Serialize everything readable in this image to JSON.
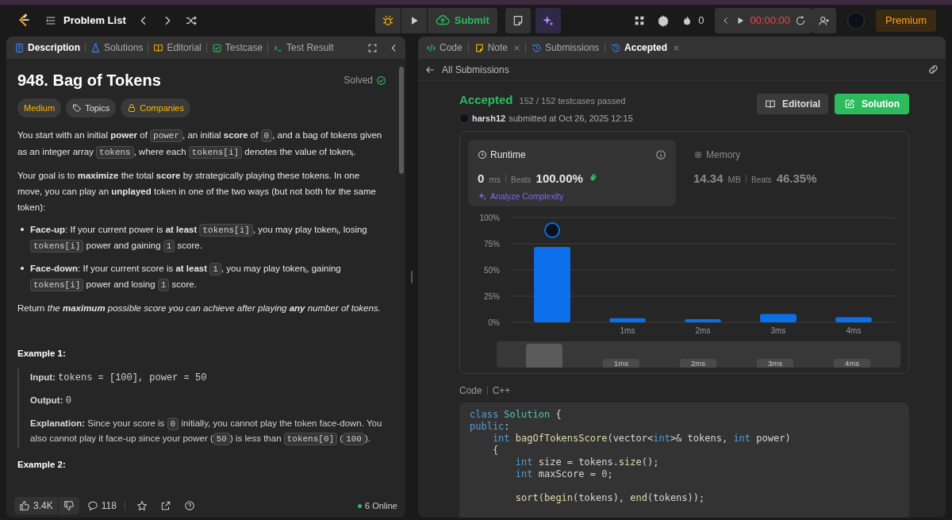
{
  "topbar": {
    "problem_list": "Problem List",
    "submit": "Submit",
    "streak": "0",
    "timer": "00:00:00",
    "premium": "Premium"
  },
  "left_tabs": [
    {
      "label": "Description",
      "selected": true
    },
    {
      "label": "Solutions",
      "selected": false
    },
    {
      "label": "Editorial",
      "selected": false
    },
    {
      "label": "Testcase",
      "selected": false
    },
    {
      "label": "Test Result",
      "selected": false
    }
  ],
  "problem": {
    "title": "948. Bag of Tokens",
    "status": "Solved",
    "difficulty": "Medium",
    "topics": "Topics",
    "companies": "Companies",
    "paragraphs": [
      {
        "kind": "para",
        "segments": [
          {
            "kind": "text",
            "text": "You start with an initial **power** of "
          },
          {
            "kind": "code",
            "text": "power"
          },
          {
            "kind": "text",
            "text": ", an initial **score** of "
          },
          {
            "kind": "code",
            "text": "0"
          },
          {
            "kind": "text",
            "text": ", and a bag of tokens given as an integer array "
          },
          {
            "kind": "code",
            "text": "tokens"
          },
          {
            "kind": "text",
            "text": ", where each "
          },
          {
            "kind": "code",
            "text": "tokens[i]"
          },
          {
            "kind": "text",
            "text": " denotes the value of token$_{i}$."
          }
        ]
      },
      {
        "kind": "para",
        "segments": [
          {
            "kind": "text",
            "text": "Your goal is to **maximize** the total **score** by strategically playing these tokens. In one move, you can play an **unplayed** token in one of the two ways (but not both for the same token):"
          }
        ]
      },
      {
        "kind": "bullet",
        "segments": [
          {
            "kind": "text",
            "text": "**Face-up**: If your current power is **at least** "
          },
          {
            "kind": "code",
            "text": "tokens[i]"
          },
          {
            "kind": "text",
            "text": ", you may play token$_{i}$, losing "
          },
          {
            "kind": "code",
            "text": "tokens[i]"
          },
          {
            "kind": "text",
            "text": " power and gaining "
          },
          {
            "kind": "code",
            "text": "1"
          },
          {
            "kind": "text",
            "text": " score."
          }
        ]
      },
      {
        "kind": "bullet",
        "segments": [
          {
            "kind": "text",
            "text": "**Face-down**: If your current score is **at least** "
          },
          {
            "kind": "code",
            "text": "1"
          },
          {
            "kind": "text",
            "text": ", you may play token$_{i}$, gaining "
          },
          {
            "kind": "code",
            "text": "tokens[i]"
          },
          {
            "kind": "text",
            "text": " power and losing "
          },
          {
            "kind": "code",
            "text": "1"
          },
          {
            "kind": "text",
            "text": " score."
          }
        ]
      },
      {
        "kind": "para",
        "segments": [
          {
            "kind": "text",
            "text": "Return "
          },
          {
            "kind": "em",
            "text": "the"
          },
          {
            "kind": "em_strong",
            "text": "maximum"
          },
          {
            "kind": "em",
            "text": "possible score you can achieve after playing"
          },
          {
            "kind": "em_strong",
            "text": "any"
          },
          {
            "kind": "em",
            "text": "number of tokens."
          }
        ]
      }
    ],
    "examples": [
      {
        "title": "Example 1:",
        "lines": [
          {
            "label": "Input:",
            "segments": [
              {
                "kind": "mono",
                "text": "tokens = [100], power = 50"
              }
            ]
          },
          {
            "label": "Output:",
            "segments": [
              {
                "kind": "mono",
                "text": "0"
              }
            ]
          },
          {
            "label": "Explanation:",
            "segments": [
              {
                "kind": "text",
                "text": "Since your score is "
              },
              {
                "kind": "code",
                "text": "0"
              },
              {
                "kind": "text",
                "text": " initially, you cannot play the token face-down. You also cannot play it face-up since your power ("
              },
              {
                "kind": "code",
                "text": "50"
              },
              {
                "kind": "text",
                "text": ") is less than "
              },
              {
                "kind": "code",
                "text": "tokens[0]"
              },
              {
                "kind": "text",
                "text": " ("
              },
              {
                "kind": "code",
                "text": "100"
              },
              {
                "kind": "text",
                "text": ")."
              }
            ]
          }
        ]
      },
      {
        "title": "Example 2:"
      }
    ]
  },
  "footer": {
    "likes": "3.4K",
    "comments": "118",
    "online": "6 Online"
  },
  "right_tabs": [
    {
      "label": "Code",
      "closable": false,
      "selected": false
    },
    {
      "label": "Note",
      "closable": true,
      "selected": false
    },
    {
      "label": "Submissions",
      "closable": false,
      "selected": false
    },
    {
      "label": "Accepted",
      "closable": true,
      "selected": true
    }
  ],
  "submission": {
    "back": "All Submissions",
    "status": "Accepted",
    "testcases": "152 / 152 testcases passed",
    "user": "harsh12",
    "submitted": "submitted at Oct 26, 2025 12:15",
    "editorial": "Editorial",
    "solution": "Solution",
    "runtime": {
      "label": "Runtime",
      "value": "0",
      "unit": "ms",
      "beats_label": "Beats",
      "beats": "100.00%",
      "analyze": "Analyze Complexity",
      "selected": true
    },
    "memory": {
      "label": "Memory",
      "value": "14.34",
      "unit": "MB",
      "beats_label": "Beats",
      "beats": "46.35%",
      "selected": false
    },
    "chart_data": {
      "type": "bar",
      "categories": [
        null,
        "1ms",
        "2ms",
        "3ms",
        "4ms"
      ],
      "series": [
        {
          "color": "#0a6fe8",
          "values": [
            72,
            4,
            3,
            8,
            5
          ]
        }
      ],
      "ylim": [
        0,
        100
      ],
      "grid": true,
      "yticks": [
        {
          "value": 0,
          "label": "0%"
        },
        {
          "value": 25,
          "label": "25%"
        },
        {
          "value": 50,
          "label": "50%"
        },
        {
          "value": 75,
          "label": "75%"
        },
        {
          "value": 100,
          "label": "100%"
        }
      ]
    },
    "navigator_labels": [
      "1ms",
      "2ms",
      "3ms",
      "4ms"
    ],
    "code_label": "Code",
    "language": "C++",
    "code": [
      {
        "kind": "line",
        "segments": [
          {
            "kind": "kw",
            "text": "class"
          },
          {
            "kind": "cls",
            "text": " Solution"
          },
          {
            "kind": "plain",
            "text": " {"
          }
        ]
      },
      {
        "kind": "line",
        "segments": [
          {
            "kind": "kw",
            "text": "public"
          },
          {
            "kind": "plain",
            "text": ":"
          }
        ]
      },
      {
        "kind": "line",
        "segments": [
          {
            "kind": "kw",
            "text": "    int"
          },
          {
            "kind": "fn",
            "text": " bagOfTokensScore"
          },
          {
            "kind": "plain",
            "text": "(vector<"
          },
          {
            "kind": "kw",
            "text": "int"
          },
          {
            "kind": "plain",
            "text": ">& tokens, "
          },
          {
            "kind": "kw",
            "text": "int"
          },
          {
            "kind": "plain",
            "text": " power)"
          }
        ]
      },
      {
        "kind": "line",
        "segments": [
          {
            "kind": "plain",
            "text": "    {"
          }
        ]
      },
      {
        "kind": "line",
        "segments": [
          {
            "kind": "kw",
            "text": "        int"
          },
          {
            "kind": "plain",
            "text": " size = tokens."
          },
          {
            "kind": "fn",
            "text": "size"
          },
          {
            "kind": "plain",
            "text": "();"
          }
        ]
      },
      {
        "kind": "line",
        "segments": [
          {
            "kind": "kw",
            "text": "        int"
          },
          {
            "kind": "plain",
            "text": " maxScore = "
          },
          {
            "kind": "num",
            "text": "0"
          },
          {
            "kind": "plain",
            "text": ";"
          }
        ]
      },
      {
        "kind": "blank"
      },
      {
        "kind": "line",
        "segments": [
          {
            "kind": "fn",
            "text": "        sort"
          },
          {
            "kind": "plain",
            "text": "("
          },
          {
            "kind": "fn",
            "text": "begin"
          },
          {
            "kind": "plain",
            "text": "(tokens), "
          },
          {
            "kind": "fn",
            "text": "end"
          },
          {
            "kind": "plain",
            "text": "(tokens));"
          }
        ]
      }
    ]
  }
}
